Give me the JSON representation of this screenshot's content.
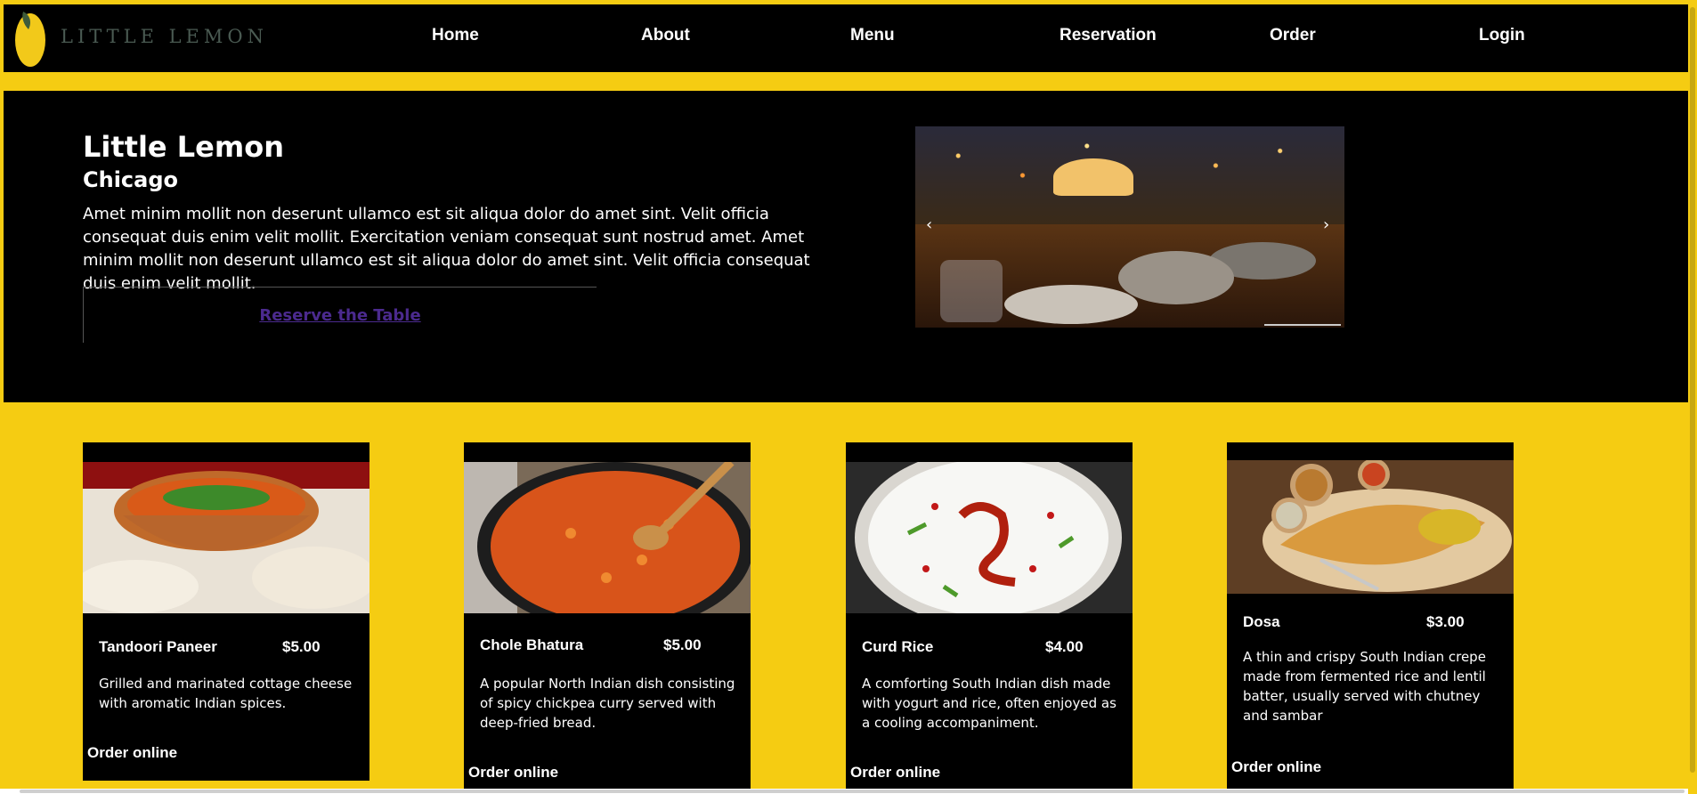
{
  "nav": {
    "logo_text": "LITTLE LEMON",
    "links": [
      "Home",
      "About",
      "Menu",
      "Reservation",
      "Order",
      "Login"
    ]
  },
  "hero": {
    "title": "Little Lemon",
    "subtitle": "Chicago",
    "description": "Amet minim mollit non deserunt ullamco est sit aliqua dolor do amet sint. Velit officia consequat duis enim velit mollit. Exercitation veniam consequat sunt nostrud amet. Amet minim mollit non deserunt ullamco est sit aliqua dolor do amet sint. Velit officia consequat duis enim velit mollit.",
    "reserve_label": "Reserve the Table",
    "carousel_prev": "‹",
    "carousel_next": "›"
  },
  "cards": [
    {
      "name": "Tandoori Paneer",
      "price": "$5.00",
      "description": "Grilled and marinated cottage cheese with aromatic Indian spices.",
      "order_label": "Order online"
    },
    {
      "name": "Chole Bhatura",
      "price": "$5.00",
      "description": "A popular North Indian dish consisting of spicy chickpea curry served with deep-fried bread.",
      "order_label": "Order online"
    },
    {
      "name": "Curd Rice",
      "price": "$4.00",
      "description": "A comforting South Indian dish made with yogurt and rice, often enjoyed as a cooling accompaniment.",
      "order_label": "Order online"
    },
    {
      "name": "Dosa",
      "price": "$3.00",
      "description": "A thin and crispy South Indian crepe made from fermented rice and lentil batter, usually served with chutney and sambar",
      "order_label": "Order online"
    }
  ],
  "colors": {
    "accent": "#f5cc12",
    "panel": "#000000",
    "link": "#4b2a8e"
  }
}
